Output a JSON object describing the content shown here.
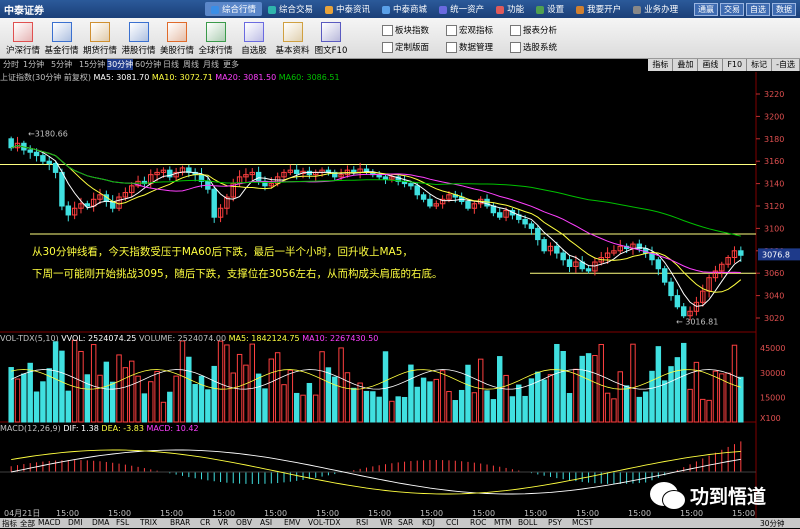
{
  "titlebar": {
    "logo": "中泰证券",
    "menus": [
      "综合行情",
      "综合交易",
      "中泰资讯",
      "中泰商城",
      "统一资产",
      "功能",
      "设置",
      "我要开户",
      "业务办理"
    ],
    "active_menu": "综合行情",
    "right_buttons": [
      "通赢",
      "交易",
      "自选",
      "数据"
    ]
  },
  "toolbar": {
    "buttons": [
      "沪深行情",
      "基金行情",
      "期货行情",
      "港股行情",
      "美股行情",
      "全球行情",
      "自选股",
      "基本资料",
      "图文F10"
    ],
    "small_buttons": [
      "板块指数",
      "宏观指标",
      "定制版面",
      "数据管理",
      "报表分析",
      "选股系统"
    ]
  },
  "periods": [
    "分时",
    "1分钟",
    "5分钟",
    "15分钟",
    "30分钟",
    "60分钟",
    "日线",
    "周线",
    "月线",
    "更多"
  ],
  "selected_period": "30分钟",
  "right_tools": [
    "指标",
    "叠加",
    "画线",
    "F10",
    "标记",
    "-自选"
  ],
  "ma_legend": {
    "name": "上证指数(30分钟 前复权)",
    "ma5": "MA5: 3081.70",
    "ma10": "MA10: 3072.71",
    "ma20": "MA20: 3081.50",
    "ma60": "MA60: 3086.51"
  },
  "price_ticks": [
    "3220",
    "3200",
    "3180",
    "3160",
    "3140",
    "3120",
    "3100",
    "3080",
    "3060",
    "3040",
    "3020"
  ],
  "current_price": "3076.8",
  "high_label": "3180.66",
  "low_label": "3016.81",
  "annotation": {
    "line1": "从30分钟线看，今天指数受压于MA60后下跌，最后一半个小时，回升收上MA5，",
    "line2": "下周一可能刚开始挑战3095，随后下跌，支撑位在3056左右，从而构成头肩底的右底。"
  },
  "vol_legend": {
    "name": "VOL-TDX(5,10)",
    "vvol": "VVOL: 2524074.25",
    "volume": "VOLUME: 2524074.00",
    "ma5": "MA5: 1842124.75",
    "ma10": "MA10: 2267430.50"
  },
  "vol_ticks": [
    "45000",
    "30000",
    "15000",
    "X100"
  ],
  "macd_legend": {
    "name": "MACD(12,26,9)",
    "dif": "DIF: 1.38",
    "dea": "DEA: -3.83",
    "macd": "MACD: 10.42"
  },
  "time_labels": [
    "04月21日",
    "15:00",
    "15:00",
    "15:00",
    "15:00",
    "15:00",
    "15:00",
    "15:00",
    "15:00",
    "15:00",
    "15:00",
    "15:00",
    "15:00",
    "15:00",
    "15:00"
  ],
  "indicator_tabs": [
    "指标",
    "全部",
    "MACD",
    "DMI",
    "DMA",
    "FSL",
    "TRIX",
    "BRAR",
    "CR",
    "VR",
    "OBV",
    "ASI",
    "EMV",
    "VOL-TDX",
    "RSI",
    "WR",
    "SAR",
    "KDJ",
    "CCI",
    "ROC",
    "MTM",
    "BOLL",
    "PSY",
    "MCST"
  ],
  "bottom_right": "30分钟",
  "watermark": "功到悟道",
  "colors": {
    "up": "#ff4040",
    "down": "#40e0e0",
    "ma5": "#ffffff",
    "ma10": "#ffff40",
    "ma20": "#ff40ff",
    "ma60": "#00c000",
    "hline": "#ffff80"
  }
}
